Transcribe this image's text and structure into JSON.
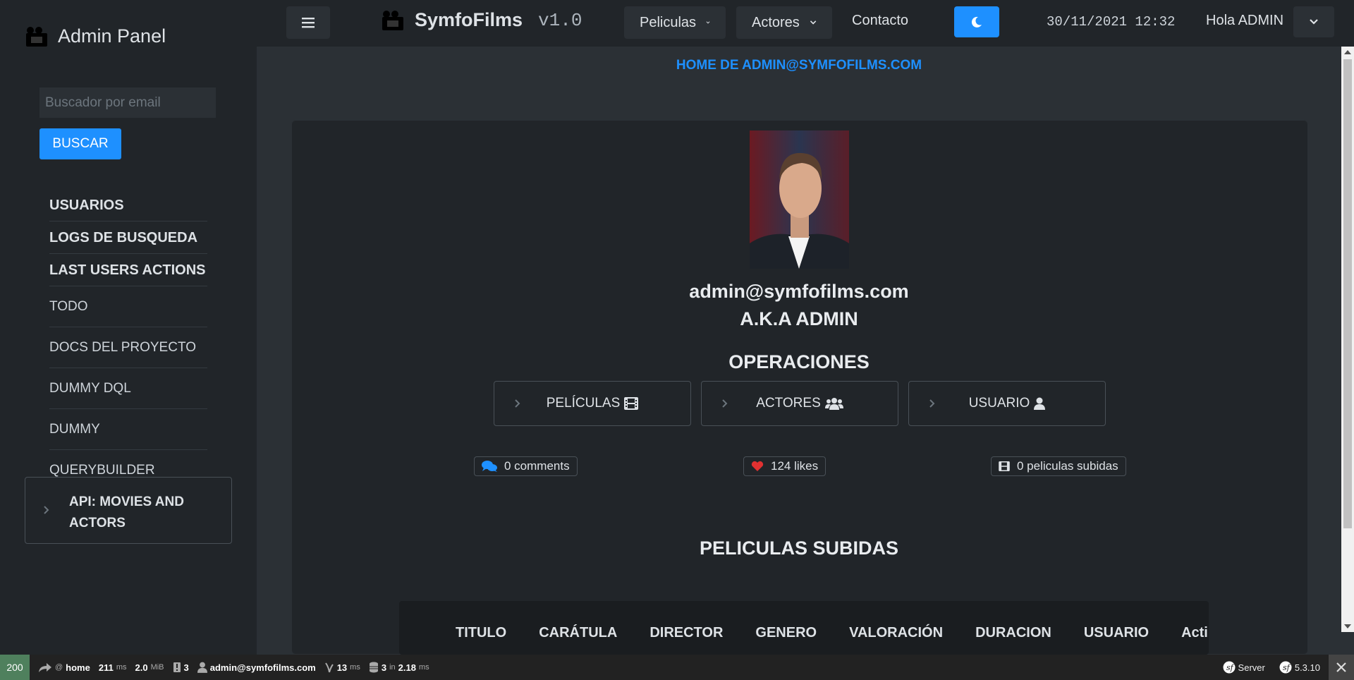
{
  "sidebar": {
    "brand_title": "Admin Panel",
    "search_placeholder": "Buscador por email",
    "search_button": "BUSCAR",
    "nav_bold": [
      "USUARIOS",
      "LOGS DE BUSQUEDA",
      "LAST USERS ACTIONS"
    ],
    "nav_light": [
      "TODO",
      "DOCS DEL PROYECTO",
      "DUMMY DQL",
      "DUMMY QUERYBUILDER"
    ],
    "api_card": "API: MOVIES AND ACTORS"
  },
  "topbar": {
    "logo": "SymfoFilms",
    "version": "v1.0",
    "menu_peliculas": "Peliculas",
    "menu_actores": "Actores",
    "contacto": "Contacto",
    "datetime": "30/11/2021 12:32",
    "greeting": "Hola ADMIN"
  },
  "main": {
    "home_title": "HOME DE ADMIN@SYMFOFILMS.COM",
    "email": "admin@symfofilms.com",
    "aka": "A.K.A ADMIN",
    "operations_title": "OPERACIONES",
    "operations": [
      {
        "label": "PELÍCULAS",
        "icon": "film-icon"
      },
      {
        "label": "ACTORES",
        "icon": "users-icon"
      },
      {
        "label": "USUARIO",
        "icon": "user-icon"
      }
    ],
    "badges": {
      "comments": "0 comments",
      "likes": "124 likes",
      "uploaded": "0 peliculas subidas"
    },
    "uploaded_title": "PELICULAS SUBIDAS",
    "table_headers": [
      "TITULO",
      "CARÁTULA",
      "DIRECTOR",
      "GENERO",
      "VALORACIÓN",
      "DURACION",
      "USUARIO",
      "Acti"
    ]
  },
  "debug": {
    "status": "200",
    "route_prefix": "@",
    "route": "home",
    "time": "211",
    "time_unit": "ms",
    "memory": "2.0",
    "memory_unit": "MiB",
    "logs": "3",
    "user": "admin@symfofilms.com",
    "twig_time": "13",
    "twig_unit": "ms",
    "db_queries": "3",
    "db_in": "in",
    "db_time": "2.18",
    "db_unit": "ms",
    "server": "Server",
    "version": "5.3.10"
  },
  "colors": {
    "accent": "#1e90ff",
    "sidebar_bg": "#212529",
    "page_bg": "#2b3035",
    "status_ok": "#4f805d",
    "heart": "#e03131"
  }
}
